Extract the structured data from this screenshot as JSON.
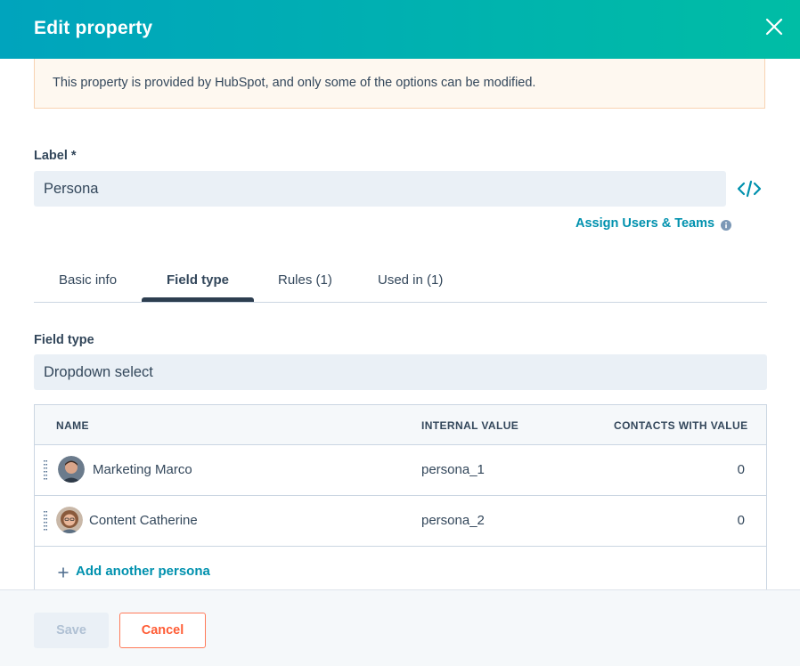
{
  "header": {
    "title": "Edit property",
    "close_icon": "close-icon"
  },
  "alert": {
    "message": "This property is provided by HubSpot, and only some of the options can be modified."
  },
  "label_field": {
    "label": "Label *",
    "value": "Persona",
    "code_icon": "code-icon"
  },
  "assign": {
    "label": "Assign Users & Teams",
    "info_icon": "info-icon"
  },
  "tabs": [
    {
      "label": "Basic info",
      "active": false
    },
    {
      "label": "Field type",
      "active": true
    },
    {
      "label": "Rules (1)",
      "active": false
    },
    {
      "label": "Used in (1)",
      "active": false
    }
  ],
  "field_type": {
    "label": "Field type",
    "value": "Dropdown select"
  },
  "table": {
    "columns": [
      "NAME",
      "INTERNAL VALUE",
      "CONTACTS WITH VALUE"
    ],
    "rows": [
      {
        "name": "Marketing Marco",
        "internal_value": "persona_1",
        "contacts": "0"
      },
      {
        "name": "Content Catherine",
        "internal_value": "persona_2",
        "contacts": "0"
      }
    ],
    "add_label": "Add another persona"
  },
  "footer": {
    "save_label": "Save",
    "cancel_label": "Cancel"
  },
  "colors": {
    "header_start": "#00a4bd",
    "header_end": "#00bda5",
    "link": "#0091ae",
    "cancel": "#ff5c35"
  }
}
